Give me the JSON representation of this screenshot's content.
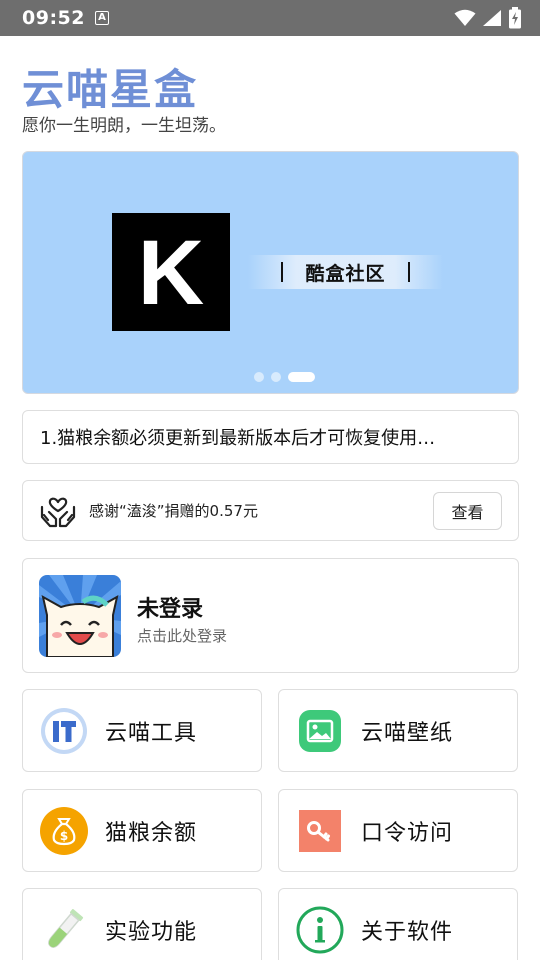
{
  "status_bar": {
    "time": "09:52",
    "notification_badge": "A",
    "icons": [
      "wifi-icon",
      "signal-icon",
      "battery-icon"
    ]
  },
  "header": {
    "title": "云喵星盒",
    "subtitle": "愿你一生明朗，一生坦荡。"
  },
  "banner": {
    "logo_letter": "K",
    "tag_text": "酷盒社区",
    "page_count": 3,
    "active_page": 3
  },
  "notice": {
    "text": "1.猫粮余额必须更新到最新版本后才可恢复使用…"
  },
  "donation": {
    "text": "感谢“溘浚”捐赠的0.57元",
    "button_label": "查看"
  },
  "user": {
    "name": "未登录",
    "hint": "点击此处登录"
  },
  "menu": {
    "items": [
      {
        "label": "云喵工具",
        "icon": "toolbox-icon"
      },
      {
        "label": "云喵壁纸",
        "icon": "wallpaper-icon"
      },
      {
        "label": "猫粮余额",
        "icon": "money-bag-icon"
      },
      {
        "label": "口令访问",
        "icon": "key-icon"
      },
      {
        "label": "实验功能",
        "icon": "test-tube-icon"
      },
      {
        "label": "关于软件",
        "icon": "info-icon"
      }
    ]
  },
  "colors": {
    "title": "#6f8fd6",
    "status_bar": "#6e6e6e",
    "banner_bg": "#a9d2fb",
    "tool_icon": "#3b6bcb",
    "wallpaper_icon": "#3ec97a",
    "money_icon": "#f5a300",
    "key_icon": "#f3826a",
    "info_icon": "#22a85a"
  }
}
